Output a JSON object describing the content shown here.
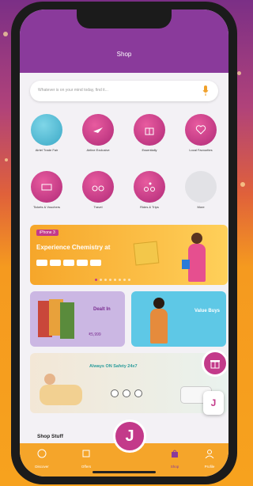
{
  "header": {
    "title": "Shop"
  },
  "search": {
    "placeholder": "Whatever is on your mind today, find it..."
  },
  "categories": [
    {
      "label": "Airtel Trade Fair"
    },
    {
      "label": "Airline Exclusive"
    },
    {
      "label": "Essentially"
    },
    {
      "label": "Local Favourites"
    },
    {
      "label": "Tickets & Vouchers"
    },
    {
      "label": "Travel"
    },
    {
      "label": "Rides & Trips"
    },
    {
      "label": "More"
    }
  ],
  "banner1": {
    "tag": "iPhone 3",
    "title": "Experience Chemistry at"
  },
  "tile1": {
    "title": "Dealt In",
    "price": "₹5,999"
  },
  "tile2": {
    "title": "Value Buys"
  },
  "banner3": {
    "title": "Always ON Safety 24x7"
  },
  "section_title": "Shop Stuff",
  "fab_label": "J",
  "tabbar": {
    "items": [
      {
        "label": "Discover"
      },
      {
        "label": "Offers"
      },
      {
        "label": "Shop"
      },
      {
        "label": "Profile"
      }
    ],
    "center_label": "J"
  },
  "colors": {
    "brand_purple": "#8a3a9b",
    "brand_pink": "#c33a8a",
    "tabbar_orange": "#f5a52a"
  }
}
